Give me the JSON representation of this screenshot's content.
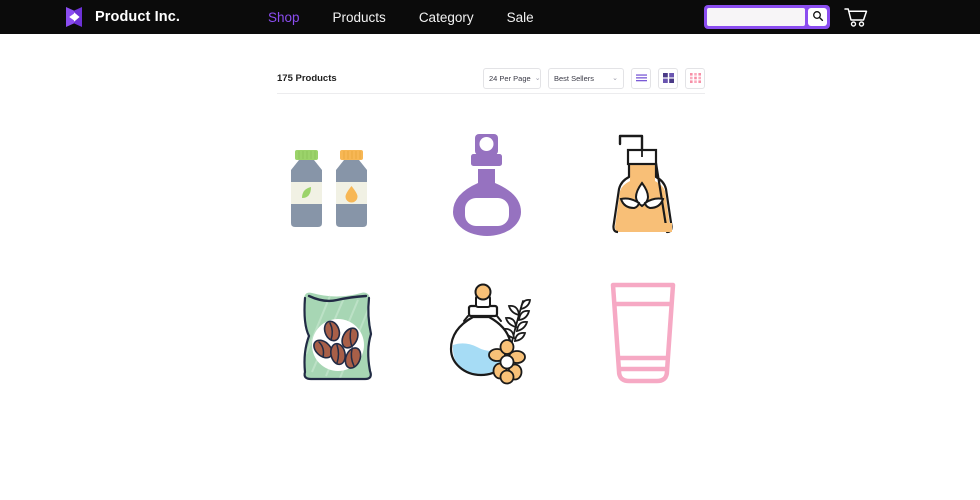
{
  "header": {
    "brand_name": "Product Inc.",
    "logo_icon": "brand-logo-icon",
    "accent_color": "#8b4df0",
    "background_color": "#0b0b0b",
    "nav": [
      {
        "label": "Shop",
        "active": true
      },
      {
        "label": "Products",
        "active": false
      },
      {
        "label": "Category",
        "active": false
      },
      {
        "label": "Sale",
        "active": false
      }
    ],
    "search": {
      "value": "",
      "placeholder": "",
      "button_icon": "search-icon"
    },
    "cart": {
      "icon": "shopping-cart-icon"
    }
  },
  "toolbar": {
    "product_count": "175 Products",
    "per_page": {
      "value": "24 Per Page",
      "caret": "⌄"
    },
    "sort": {
      "value": "Best Sellers",
      "caret": "⌄"
    },
    "views": [
      {
        "name": "list-view",
        "icon": "list-view-icon",
        "color": "#7a5ad6",
        "active": false
      },
      {
        "name": "grid-view",
        "icon": "grid-view-icon",
        "color": "#4a3a86",
        "active": true
      },
      {
        "name": "compact-grid-view",
        "icon": "compact-grid-view-icon",
        "color": "#f78fa7",
        "active": false
      }
    ]
  },
  "products": [
    {
      "name": "twin-bottles",
      "alt": "Two bottles with green leaf and orange droplet labels"
    },
    {
      "name": "purple-flask",
      "alt": "Purple round flask bottle"
    },
    {
      "name": "soap-dispenser",
      "alt": "Pump soap dispenser with orange liquid and leaf motif"
    },
    {
      "name": "coffee-pouch",
      "alt": "Green pouch with coffee beans window"
    },
    {
      "name": "blue-potion-bottle",
      "alt": "Round bottle with blue liquid and chamomile flowers"
    },
    {
      "name": "cosmetic-tube",
      "alt": "Pink outlined cosmetic tube"
    }
  ]
}
